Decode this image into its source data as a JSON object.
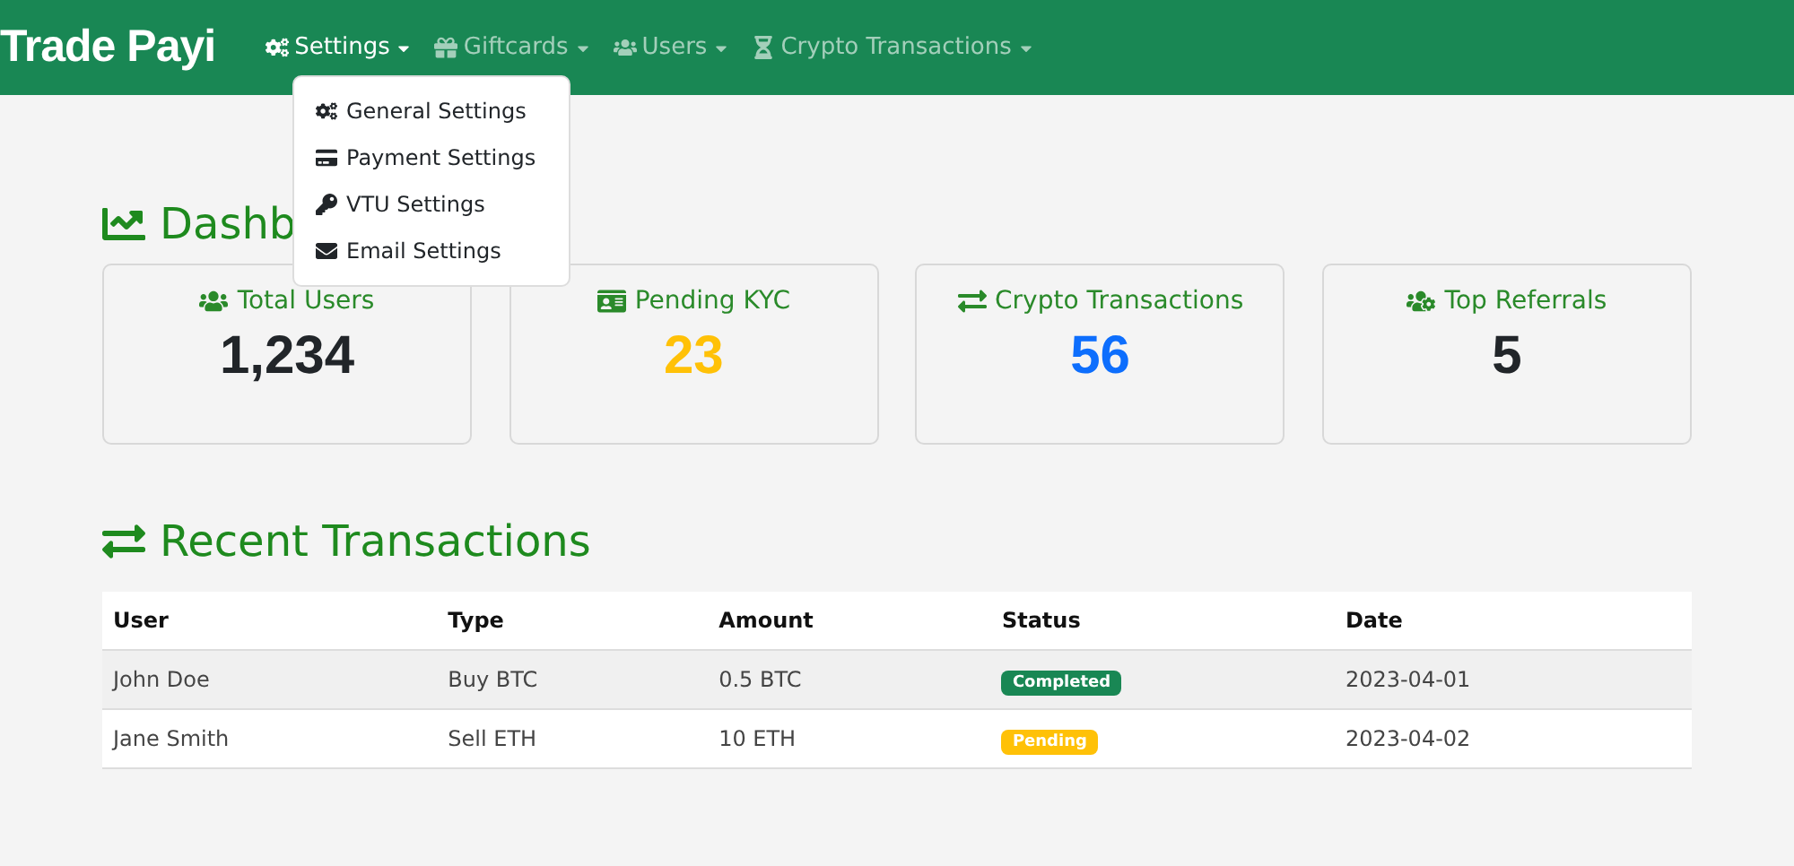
{
  "brand": "Trade Payi",
  "nav": [
    {
      "label": "Settings",
      "expanded": true
    },
    {
      "label": "Giftcards",
      "expanded": false
    },
    {
      "label": "Users",
      "expanded": false
    },
    {
      "label": "Crypto Transactions",
      "expanded": false
    }
  ],
  "settings_menu": [
    "General Settings",
    "Payment Settings",
    "VTU Settings",
    "Email Settings"
  ],
  "dashboard_title": "Dashb",
  "cards": [
    {
      "title": "Total Users",
      "value": "1,234",
      "color": "#212529"
    },
    {
      "title": "Pending KYC",
      "value": "23",
      "color": "#ffc107"
    },
    {
      "title": "Crypto Transactions",
      "value": "56",
      "color": "#0d6efd"
    },
    {
      "title": "Top Referrals",
      "value": "5",
      "color": "#212529"
    }
  ],
  "recent_title": "Recent Transactions",
  "table": {
    "columns": [
      "User",
      "Type",
      "Amount",
      "Status",
      "Date"
    ],
    "rows": [
      {
        "user": "John Doe",
        "type": "Buy BTC",
        "amount": "0.5 BTC",
        "status": "Completed",
        "color": "#198754",
        "date": "2023-04-01"
      },
      {
        "user": "Jane Smith",
        "type": "Sell ETH",
        "amount": "10 ETH",
        "status": "Pending",
        "color": "#ffc107",
        "date": "2023-04-02"
      }
    ]
  }
}
